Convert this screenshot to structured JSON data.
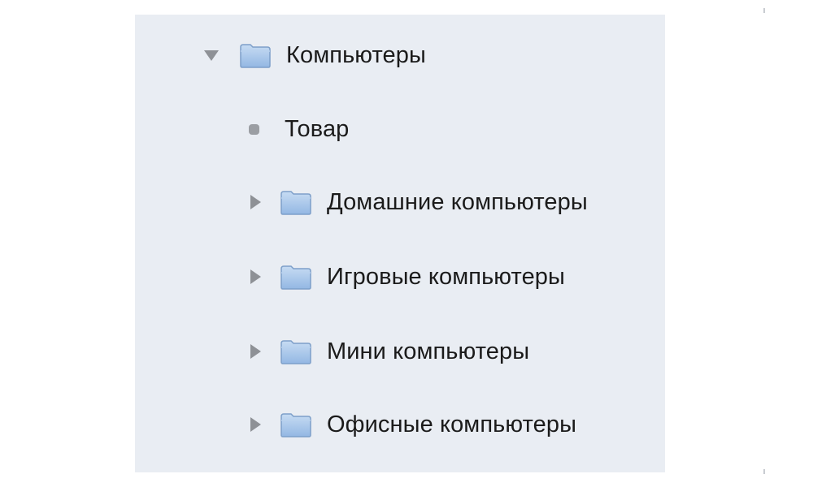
{
  "tree": {
    "root": {
      "label": "Компьютеры",
      "icon": "folder-icon",
      "expanded": true
    },
    "leaf": {
      "label": "Товар",
      "icon": "bullet-icon"
    },
    "children": [
      {
        "label": "Домашние компьютеры",
        "icon": "folder-icon",
        "expanded": false
      },
      {
        "label": "Игровые компьютеры",
        "icon": "folder-icon",
        "expanded": false
      },
      {
        "label": "Мини компьютеры",
        "icon": "folder-icon",
        "expanded": false
      },
      {
        "label": "Офисные компьютеры",
        "icon": "folder-icon",
        "expanded": false
      }
    ]
  },
  "colors": {
    "panel_background": "#e9edf3",
    "folder_fill": "#a9c7ea",
    "folder_stroke": "#7d9fc9",
    "disclosure": "#8e9196",
    "text": "#1b1b1b"
  }
}
